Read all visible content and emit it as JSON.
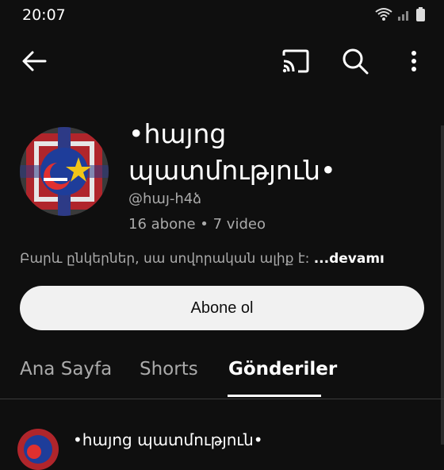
{
  "status_bar": {
    "time": "20:07"
  },
  "app_bar": {
    "back_icon": "arrow-left-icon",
    "cast_icon": "cast-icon",
    "search_icon": "search-icon",
    "more_icon": "more-vertical-icon"
  },
  "channel": {
    "name": "•հայոց պատմություն•",
    "handle": "@հայ-հ4ձ",
    "stats": "16 abone • 7 video",
    "description": "Բարև ընկերներ, սա սովորական ալիք է:",
    "more_label": "...devamı"
  },
  "subscribe_label": "Abone ol",
  "tabs": [
    {
      "label": "Ana Sayfa",
      "active": false
    },
    {
      "label": "Shorts",
      "active": false
    },
    {
      "label": "Gönderiler",
      "active": true
    }
  ],
  "post": {
    "author": "•հայոց պատմություն•"
  },
  "colors": {
    "background": "#0f0f0f",
    "button_bg": "#f1f1f1",
    "text_secondary": "#aaaaaa"
  }
}
